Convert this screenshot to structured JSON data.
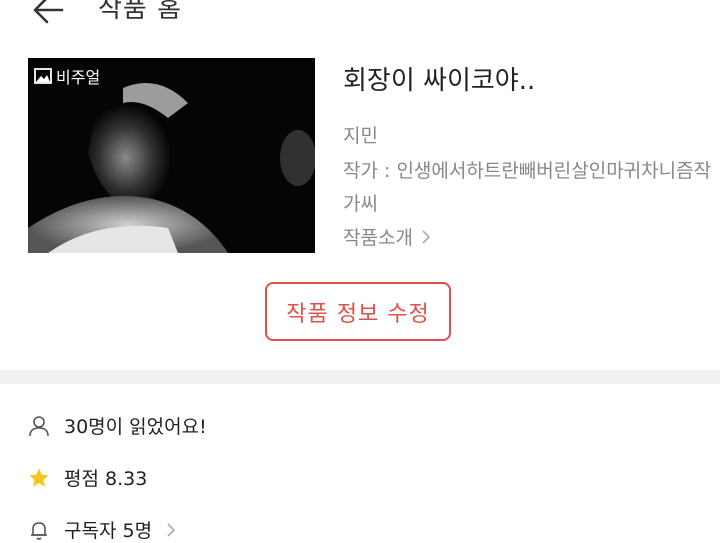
{
  "header": {
    "title": "작품 홈",
    "back_icon": "arrow-left-icon"
  },
  "cover": {
    "badge_icon": "image-icon",
    "badge_label": "비주얼"
  },
  "work": {
    "title": "회장이 싸이코야..",
    "author": "지민",
    "writer": "작가 : 인생에서하트란빼버린살인마귀차니즘작가씨",
    "intro_label": "작품소개"
  },
  "edit_button_label": "작품 정보 수정",
  "stats": {
    "readers": "30명이 읽었어요!",
    "rating": "평점 8.33",
    "subscribers": "구독자 5명"
  },
  "colors": {
    "accent": "#e0504a",
    "star": "#f5c518",
    "muted_text": "#888888",
    "divider": "#f0f0f0"
  }
}
